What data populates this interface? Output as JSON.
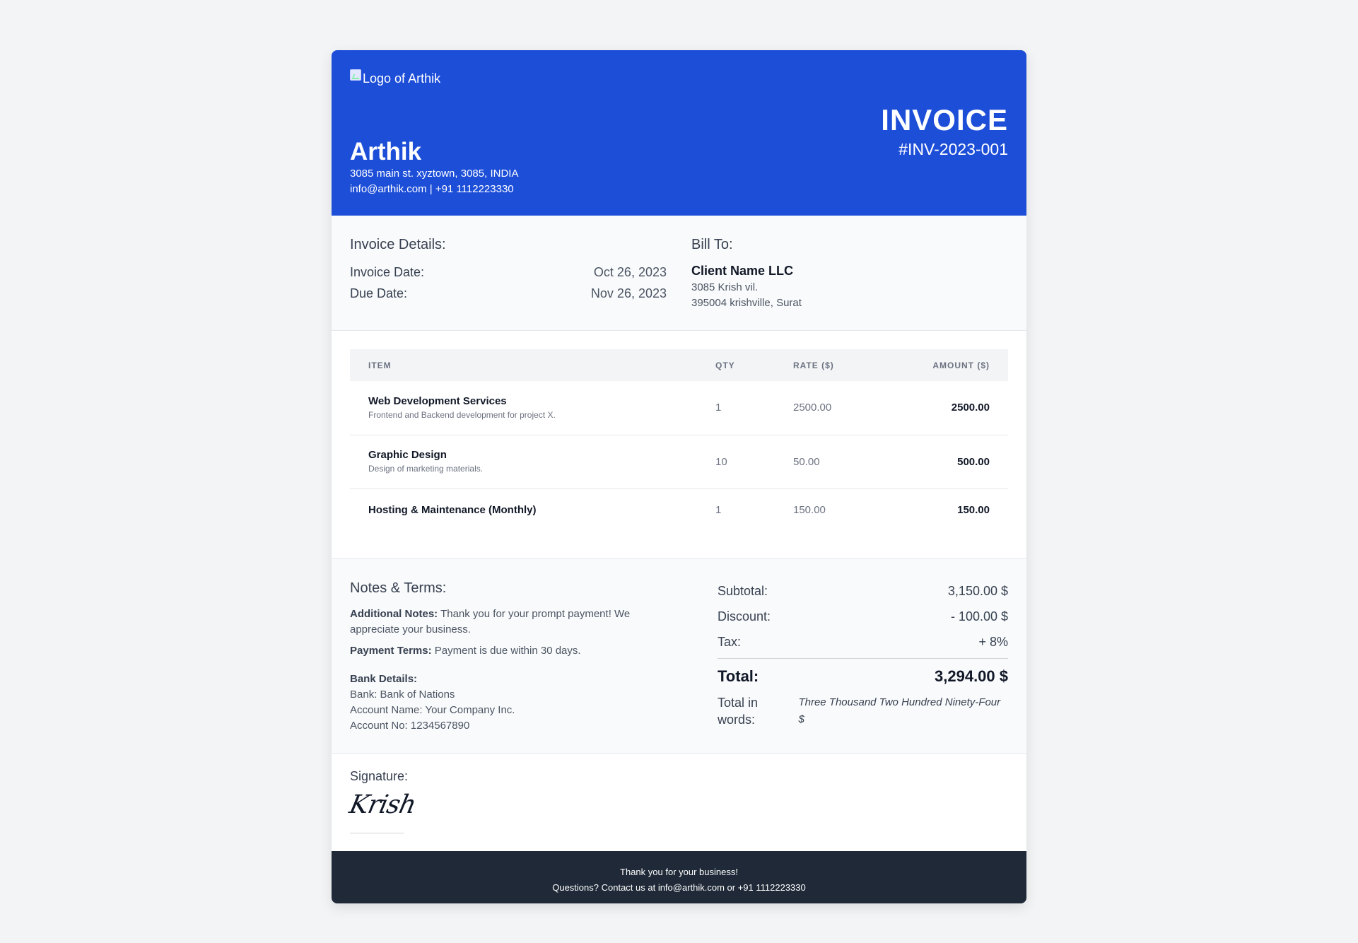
{
  "header": {
    "logo_alt": "Logo of Arthik",
    "company_name": "Arthik",
    "address": "3085 main st. xyztown, 3085, INDIA",
    "contact": "info@arthik.com | +91 1112223330",
    "doc_title": "INVOICE",
    "invoice_number": "#INV-2023-001",
    "colors": {
      "header_bg": "#1d4ed8",
      "footer_bg": "#1f2937"
    }
  },
  "details": {
    "heading": "Invoice Details:",
    "invoice_date_label": "Invoice Date:",
    "invoice_date": "Oct 26, 2023",
    "due_date_label": "Due Date:",
    "due_date": "Nov 26, 2023"
  },
  "bill_to": {
    "heading": "Bill To:",
    "name": "Client Name LLC",
    "line1": "3085 Krish vil.",
    "line2": "395004 krishville, Surat"
  },
  "table": {
    "headers": {
      "item": "ITEM",
      "qty": "QTY",
      "rate": "RATE ($)",
      "amount": "AMOUNT ($)"
    },
    "rows": [
      {
        "name": "Web Development Services",
        "desc": "Frontend and Backend development for project X.",
        "qty": "1",
        "rate": "2500.00",
        "amount": "2500.00"
      },
      {
        "name": "Graphic Design",
        "desc": "Design of marketing materials.",
        "qty": "10",
        "rate": "50.00",
        "amount": "500.00"
      },
      {
        "name": "Hosting & Maintenance (Monthly)",
        "desc": "",
        "qty": "1",
        "rate": "150.00",
        "amount": "150.00"
      }
    ]
  },
  "notes": {
    "heading": "Notes & Terms:",
    "additional_label": "Additional Notes:",
    "additional_text": "Thank you for your prompt payment! We appreciate your business.",
    "terms_label": "Payment Terms:",
    "terms_text": "Payment is due within 30 days.",
    "bank_label": "Bank Details:",
    "bank_name": "Bank: Bank of Nations",
    "account_name": "Account Name: Your Company Inc.",
    "account_no": "Account No: 1234567890"
  },
  "totals": {
    "subtotal_label": "Subtotal:",
    "subtotal": "3,150.00 $",
    "discount_label": "Discount:",
    "discount": "- 100.00 $",
    "tax_label": "Tax:",
    "tax": "+ 8%",
    "total_label": "Total:",
    "total": "3,294.00 $",
    "words_label": "Total in words:",
    "words": "Three Thousand Two Hundred Ninety-Four $"
  },
  "signature": {
    "label": "Signature:",
    "name": "Krish"
  },
  "footer": {
    "line1": "Thank you for your business!",
    "line2": "Questions? Contact us at info@arthik.com or +91 1112223330"
  }
}
